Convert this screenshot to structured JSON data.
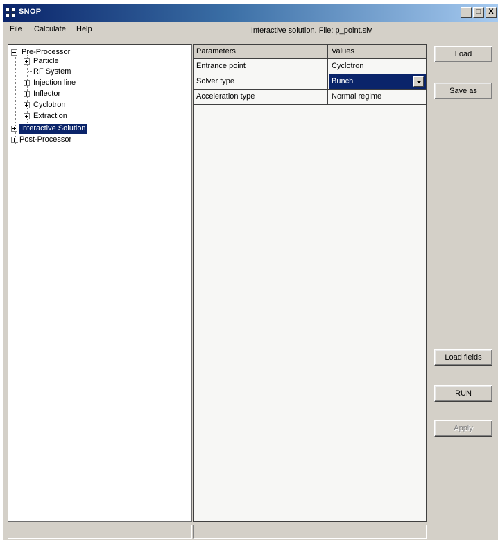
{
  "window": {
    "title": "SNOP",
    "controls": {
      "minimize": "_",
      "maximize": "□",
      "close": "X"
    }
  },
  "menu": [
    "File",
    "Calculate",
    "Help"
  ],
  "header": {
    "title": "Interactive solution. File: p_point.slv"
  },
  "tree": {
    "pre_processor": {
      "label": "Pre-Processor",
      "children": [
        "Particle",
        "RF System",
        "Injection line",
        "Inflector",
        "Cyclotron",
        "Extraction"
      ]
    },
    "interactive_solution": "Interactive Solution",
    "post_processor": "Post-Processor"
  },
  "grid": {
    "headers": {
      "param": "Parameters",
      "value": "Values"
    },
    "rows": [
      {
        "param": "Entrance point",
        "value": "Cyclotron"
      },
      {
        "param": "Solver type",
        "value": "Bunch"
      },
      {
        "param": "Acceleration type",
        "value": "Normal regime"
      }
    ]
  },
  "buttons": {
    "load": "Load",
    "save_as": "Save as",
    "load_fields": "Load fields",
    "run": "RUN",
    "apply": "Apply"
  },
  "colors": {
    "title_bar": "#0a246a",
    "selection": "#0a246a",
    "face": "#d4d0c8"
  }
}
